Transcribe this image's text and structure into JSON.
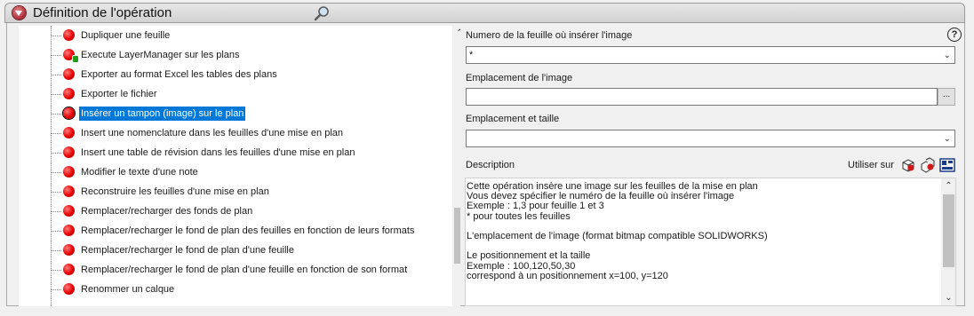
{
  "header": {
    "title": "Définition de l'opération"
  },
  "tree": {
    "items": [
      {
        "label": "Dupliquer une feuille"
      },
      {
        "label": "Execute LayerManager sur les plans"
      },
      {
        "label": "Exporter au format Excel les tables des plans"
      },
      {
        "label": "Exporter le fichier"
      },
      {
        "label": "Insérer un tampon (image) sur le plan"
      },
      {
        "label": "Insert une nomenclature dans les feuilles d'une mise en plan"
      },
      {
        "label": "Insert une table de révision dans les feuilles d'une mise en plan"
      },
      {
        "label": "Modifier le texte d'une note"
      },
      {
        "label": "Reconstruire les feuilles d'une mise en plan"
      },
      {
        "label": "Remplacer/recharger des fonds de plan"
      },
      {
        "label": "Remplacer/recharger le fond de plan des feuilles en fonction de leurs formats"
      },
      {
        "label": "Remplacer/recharger le fond de plan d'une feuille"
      },
      {
        "label": "Remplacer/recharger le fond de plan d'une feuille en fonction de son format"
      },
      {
        "label": "Renommer un calque"
      }
    ],
    "selected_index": 4
  },
  "form": {
    "sheet_number_label": "Numero de la feuille où insérer l'image",
    "sheet_number_value": "*",
    "image_location_label": "Emplacement de l'image",
    "image_location_value": "",
    "browse_label": "...",
    "position_size_label": "Emplacement et taille",
    "position_size_value": "",
    "description_label": "Description",
    "use_on_label": "Utiliser sur",
    "help_label": "?"
  },
  "description_lines": [
    "Cette opération insère une image sur les feuilles de la mise en plan",
    "Vous devez spécifier le numéro de la feuille où insérer l'image",
    "Exemple : 1,3 pour feuille 1 et 3",
    "* pour toutes les feuilles",
    "",
    "L'emplacement de l'image (format bitmap compatible SOLIDWORKS)",
    "",
    "Le positionnement et la taille",
    "Exemple : 100,120,50,30",
    "correspond à un positionnement x=100, y=120"
  ],
  "icons": {
    "collapse": "collapse-arrow-icon",
    "search": "search-icon",
    "use_on": [
      "part-icon",
      "assembly-icon",
      "drawing-icon"
    ]
  },
  "colors": {
    "selection": "#0078d7",
    "status_dot": "#e60000",
    "accent": "#b0303a"
  }
}
